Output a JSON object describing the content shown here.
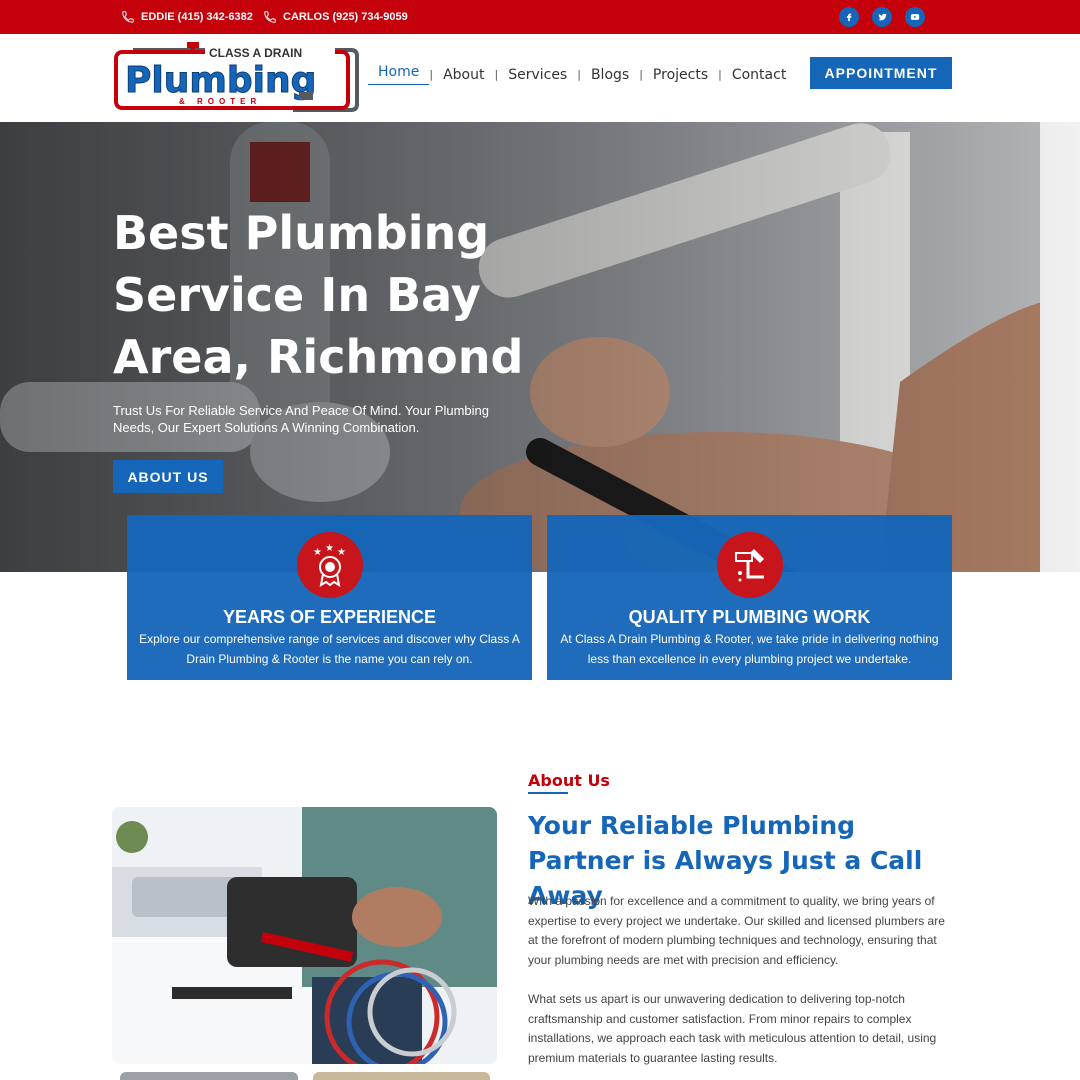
{
  "topbar": {
    "phone1": "EDDIE (415) 342-6382",
    "phone2": "CARLOS (925) 734-9059",
    "social": [
      "facebook-icon",
      "twitter-icon",
      "youtube-icon"
    ]
  },
  "logo": {
    "line1": "CLASS A DRAIN",
    "line2": "Plumbing",
    "line3": "& ROOTER"
  },
  "nav": {
    "items": [
      "Home",
      "About",
      "Services",
      "Blogs",
      "Projects",
      "Contact"
    ],
    "active": "Home"
  },
  "header": {
    "appointment_label": "APPOINTMENT"
  },
  "hero": {
    "title": "Best Plumbing Service In Bay Area, Richmond",
    "subtitle": "Trust Us For Reliable Service And Peace Of Mind. Your Plumbing Needs, Our Expert Solutions A Winning Combination.",
    "button_label": "ABOUT US"
  },
  "features": [
    {
      "title": "YEARS OF EXPERIENCE",
      "text": "Explore our comprehensive range of services and discover why Class A Drain Plumbing & Rooter is the name you can rely on.",
      "icon": "award-badge-icon"
    },
    {
      "title": "QUALITY PLUMBING WORK",
      "text": "At Class A Drain Plumbing & Rooter, we take pride in delivering nothing less than excellence in every plumbing project we undertake.",
      "icon": "pipe-wrench-icon"
    }
  ],
  "about": {
    "label": "About Us",
    "title": "Your Reliable Plumbing Partner is Always Just a Call Away",
    "paragraph1": "With a passion for excellence and a commitment to quality, we bring years of expertise to every project we undertake. Our skilled and licensed plumbers are at the forefront of modern plumbing techniques and technology, ensuring that your plumbing needs are met with precision and efficiency.",
    "paragraph2": "What sets us apart is our unwavering dedication to delivering top-notch craftsmanship and customer satisfaction. From minor repairs to complex installations, we approach each task with meticulous attention to detail, using premium materials to guarantee lasting results."
  },
  "colors": {
    "brand_red": "#c4000b",
    "brand_blue": "#1566b8"
  }
}
